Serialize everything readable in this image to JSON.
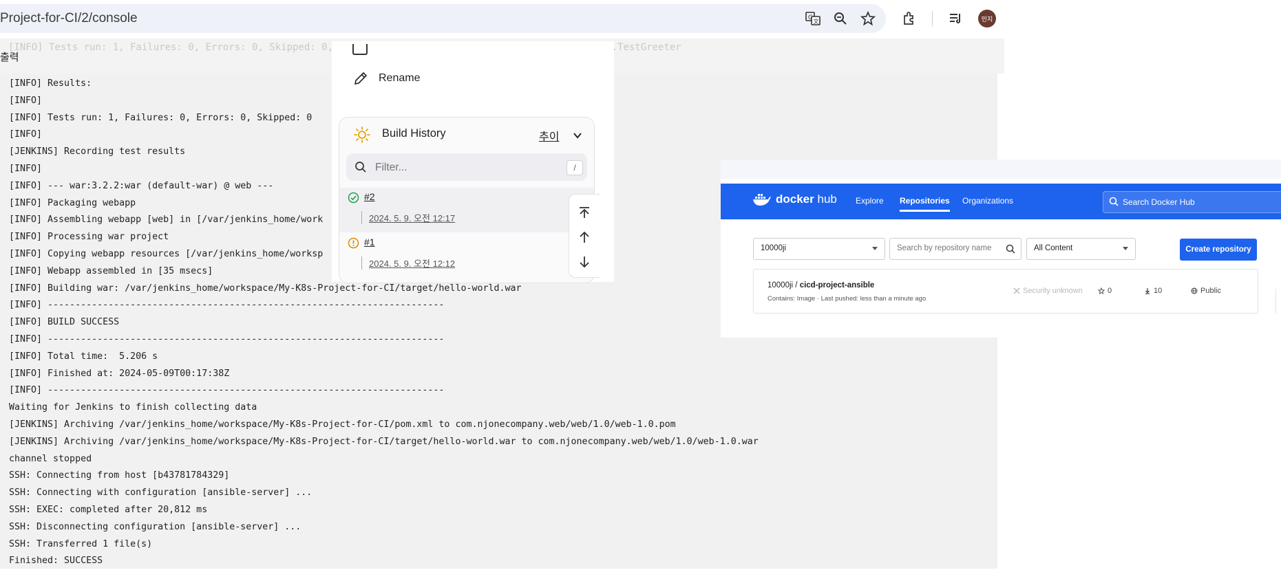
{
  "browser": {
    "address": "Project-for-CI/2/console",
    "avatar_text": "민지",
    "icons": [
      "translate-icon",
      "zoom-icon",
      "bookmark-star-icon",
      "extensions-icon",
      "reading-list-icon"
    ]
  },
  "console": {
    "ghost_line": "[INFO] Tests run: 1, Failures: 0, Errors: 0, Skipped: 0, Time elapsed: 0.xxx s - in com.njonecompany.web.TestGreeter",
    "output_title": "출력",
    "lines": [
      "[INFO] Results:",
      "[INFO]",
      "[INFO] Tests run: 1, Failures: 0, Errors: 0, Skipped: 0",
      "[INFO]",
      "[JENKINS] Recording test results",
      "[INFO]",
      "[INFO] --- war:3.2.2:war (default-war) @ web ---",
      "[INFO] Packaging webapp",
      "[INFO] Assembling webapp [web] in [/var/jenkins_home/work",
      "[INFO] Processing war project",
      "[INFO] Copying webapp resources [/var/jenkins_home/worksp",
      "[INFO] Webapp assembled in [35 msecs]",
      "[INFO] Building war: /var/jenkins_home/workspace/My-K8s-Project-for-CI/target/hello-world.war",
      "[INFO] ------------------------------------------------------------------------",
      "[INFO] BUILD SUCCESS",
      "[INFO] ------------------------------------------------------------------------",
      "[INFO] Total time:  5.206 s",
      "[INFO] Finished at: 2024-05-09T00:17:38Z",
      "[INFO] ------------------------------------------------------------------------",
      "Waiting for Jenkins to finish collecting data",
      "[JENKINS] Archiving /var/jenkins_home/workspace/My-K8s-Project-for-CI/pom.xml to com.njonecompany.web/web/1.0/web-1.0.pom",
      "[JENKINS] Archiving /var/jenkins_home/workspace/My-K8s-Project-for-CI/target/hello-world.war to com.njonecompany.web/web/1.0/web-1.0.war",
      "channel stopped",
      "SSH: Connecting from host [b43781784329]",
      "SSH: Connecting with configuration [ansible-server] ...",
      "SSH: EXEC: completed after 20,812 ms",
      "SSH: Disconnecting configuration [ansible-server] ...",
      "SSH: Transferred 1 file(s)",
      "Finished: SUCCESS"
    ]
  },
  "jenkins_panel": {
    "rename_label": "Rename",
    "build_history": {
      "title": "Build History",
      "trend_label": "추이",
      "filter_placeholder": "Filter...",
      "shortcut_key": "/",
      "builds": [
        {
          "number": "#2",
          "date": "2024. 5. 9. 오전 12:17",
          "status": "success"
        },
        {
          "number": "#1",
          "date": "2024. 5. 9. 오전 12:12",
          "status": "unstable"
        }
      ]
    }
  },
  "docker_hub": {
    "brand_main": "docker",
    "brand_sub": "hub",
    "nav": [
      "Explore",
      "Repositories",
      "Organizations"
    ],
    "active_nav": "Repositories",
    "search_placeholder": "Search Docker Hub",
    "namespace": "10000ji",
    "repo_search_placeholder": "Search by repository name",
    "content_filter": "All Content",
    "create_button": "Create repository",
    "repository": {
      "owner": "10000ji /",
      "name": "cicd-project-ansible",
      "meta": "Contains: Image  ·  Last pushed: less than a minute ago",
      "security": "Security unknown",
      "stars": "0",
      "downloads": "10",
      "visibility": "Public"
    }
  },
  "colors": {
    "docker_blue": "#1d63ed",
    "success_green": "#1ea446",
    "unstable_orange": "#e08a00"
  }
}
